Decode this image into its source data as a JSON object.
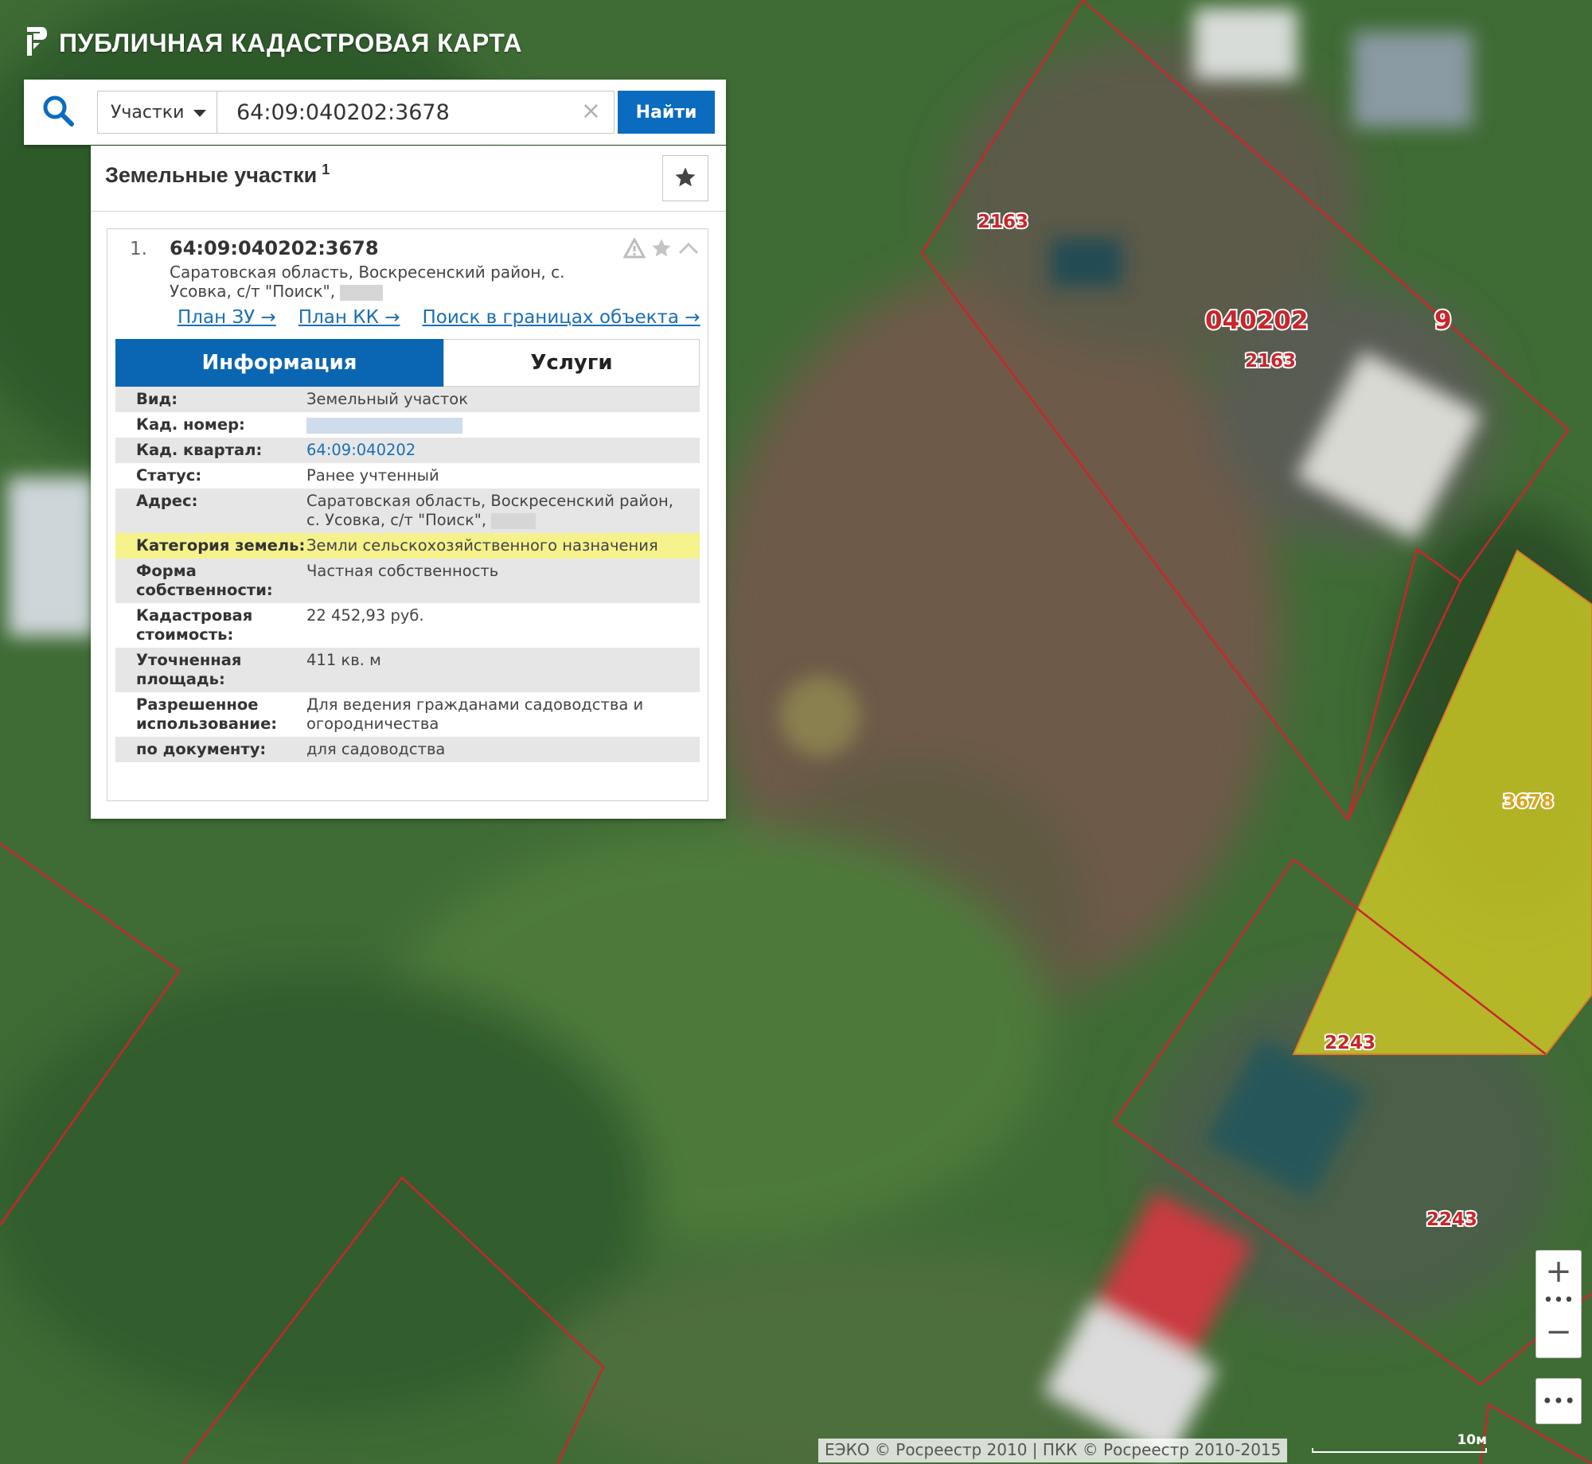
{
  "header": {
    "title": "ПУБЛИЧНАЯ КАДАСТРОВАЯ КАРТА",
    "logo_icon": "pkk-logo-icon"
  },
  "search": {
    "category": "Участки",
    "value": "64:09:040202:3678",
    "clear_symbol": "×",
    "button_label": "Найти"
  },
  "panel": {
    "title": "Земельные участки",
    "count": "1",
    "result": {
      "index": "1.",
      "cad_number": "64:09:040202:3678",
      "address": "Саратовская область, Воскресенский район, с. Усовка, с/т \"Поиск\",",
      "links": [
        "План ЗУ →",
        "План КК →",
        "Поиск в границах объекта →"
      ],
      "tabs": {
        "info": "Информация",
        "services": "Услуги"
      },
      "rows": [
        {
          "label": "Вид:",
          "value": "Земельный участок"
        },
        {
          "label": "Кад. номер:",
          "value": ""
        },
        {
          "label": "Кад. квартал:",
          "value": "64:09:040202"
        },
        {
          "label": "Статус:",
          "value": "Ранее учтенный"
        },
        {
          "label": "Адрес:",
          "value": "Саратовская область, Воскресенский район, с. Усовка, с/т \"Поиск\","
        },
        {
          "label": "Категория земель:",
          "value": "Земли сельскохозяйственного назначения"
        },
        {
          "label": "Форма собственности:",
          "value": "Частная собственность"
        },
        {
          "label": "Кадастровая стоимость:",
          "value": "22 452,93 руб."
        },
        {
          "label": "Уточненная площадь:",
          "value": "411 кв. м"
        },
        {
          "label": "Разрешенное использование:",
          "value": "Для ведения гражданами садоводства и огородничества"
        },
        {
          "label": "по документу:",
          "value": "для садоводства"
        }
      ]
    }
  },
  "map": {
    "labels": {
      "l1": "2163",
      "l2": "040202",
      "l3": "9",
      "l4": "2163",
      "l5": "3678",
      "l6": "2243",
      "l7": "2243"
    },
    "selected_fill": "#c9c626",
    "boundary_color": "#c8262c"
  },
  "controls": {
    "zoom_in": "+",
    "zoom_out": "−",
    "dots": "•••",
    "more": "•••"
  },
  "attribution": "ЕЭКО © Росреестр 2010 | ПКК © Росреестр 2010-2015",
  "scale": "10м",
  "colors": {
    "accent": "#0a6bbf",
    "highlight": "#f5f28c"
  }
}
